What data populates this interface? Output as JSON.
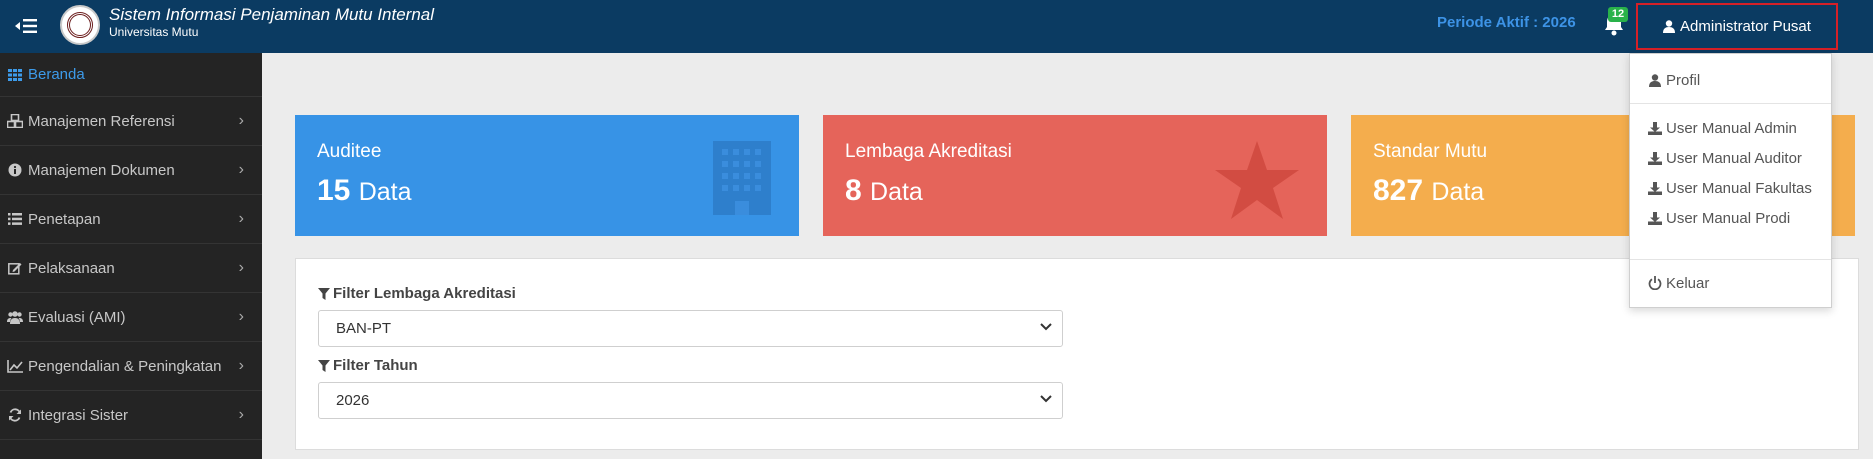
{
  "header": {
    "app_title": "Sistem Informasi Penjaminan Mutu Internal",
    "institution": "Universitas Mutu",
    "periode_label": "Periode Aktif : 2026",
    "notification_count": "12",
    "user_label": "Administrator Pusat"
  },
  "sidebar": {
    "items": [
      {
        "label": "Beranda",
        "icon": "th-icon"
      },
      {
        "label": "Manajemen Referensi",
        "icon": "cubes-icon"
      },
      {
        "label": "Manajemen Dokumen",
        "icon": "info-icon"
      },
      {
        "label": "Penetapan",
        "icon": "list-icon"
      },
      {
        "label": "Pelaksanaan",
        "icon": "edit-icon"
      },
      {
        "label": "Evaluasi (AMI)",
        "icon": "users-icon"
      },
      {
        "label": "Pengendalian & Peningkatan",
        "icon": "line-chart-icon"
      },
      {
        "label": "Integrasi Sister",
        "icon": "refresh-icon"
      }
    ],
    "chevron": "›"
  },
  "cards": [
    {
      "title": "Auditee",
      "value": "15",
      "unit": "Data",
      "icon": "building-icon",
      "color": "#3793e6"
    },
    {
      "title": "Lembaga Akreditasi",
      "value": "8",
      "unit": "Data",
      "icon": "star-icon",
      "color": "#e5645a"
    },
    {
      "title": "Standar Mutu",
      "value": "827",
      "unit": "Data",
      "icon": "book-icon",
      "color": "#f4ad4d"
    }
  ],
  "filters": {
    "lembaga_label": "Filter Lembaga Akreditasi",
    "lembaga_value": "BAN-PT",
    "tahun_label": "Filter Tahun",
    "tahun_value": "2026"
  },
  "user_menu": {
    "profil": "Profil",
    "manual_admin": "User Manual Admin",
    "manual_auditor": "User Manual Auditor",
    "manual_fakultas": "User Manual Fakultas",
    "manual_prodi": "User Manual Prodi",
    "keluar": "Keluar"
  },
  "colors": {
    "navbar": "#0b3b62",
    "sidebar": "#242424",
    "accent_blue": "#3d9bea",
    "highlight_border": "#d62027",
    "badge_green": "#29b24a"
  }
}
